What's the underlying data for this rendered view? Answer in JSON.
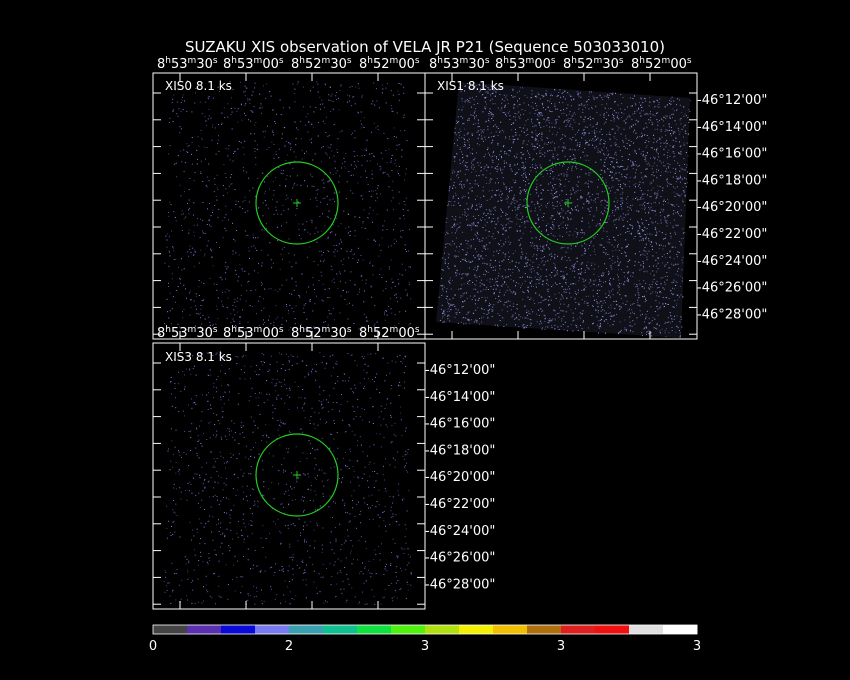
{
  "title": "SUZAKU XIS observation of VELA JR P21  (Sequence 503033010)",
  "ra_ticks": [
    {
      "h": "8",
      "m": "53",
      "s": "30"
    },
    {
      "h": "8",
      "m": "53",
      "s": "00"
    },
    {
      "h": "8",
      "m": "52",
      "s": "30"
    },
    {
      "h": "8",
      "m": "52",
      "s": "00"
    }
  ],
  "dec_ticks": [
    "-46°12'00\"",
    "-46°14'00\"",
    "-46°16'00\"",
    "-46°18'00\"",
    "-46°20'00\"",
    "-46°22'00\"",
    "-46°24'00\"",
    "-46°26'00\"",
    "-46°28'00\""
  ],
  "panels": [
    {
      "label": "XIS0  8.1 ks"
    },
    {
      "label": "XIS1  8.1 ks"
    },
    {
      "label": "XIS3  8.1 ks"
    }
  ],
  "colorbar": {
    "colors": [
      "#444444",
      "#5a2fb0",
      "#0a0ad8",
      "#7a7af0",
      "#3aa0b0",
      "#10c090",
      "#10e040",
      "#50f010",
      "#b0e010",
      "#f0f000",
      "#f0c000",
      "#b07010",
      "#e02020",
      "#f01010",
      "#e0e0e0",
      "#ffffff"
    ],
    "tick_labels": [
      "0",
      "2",
      "3",
      "3",
      "3"
    ]
  },
  "colors": {
    "region": "#22cc22",
    "events_xis0": "#8888ff",
    "events_xis1": "#9a9aee",
    "events_xis3": "#8888ff"
  }
}
